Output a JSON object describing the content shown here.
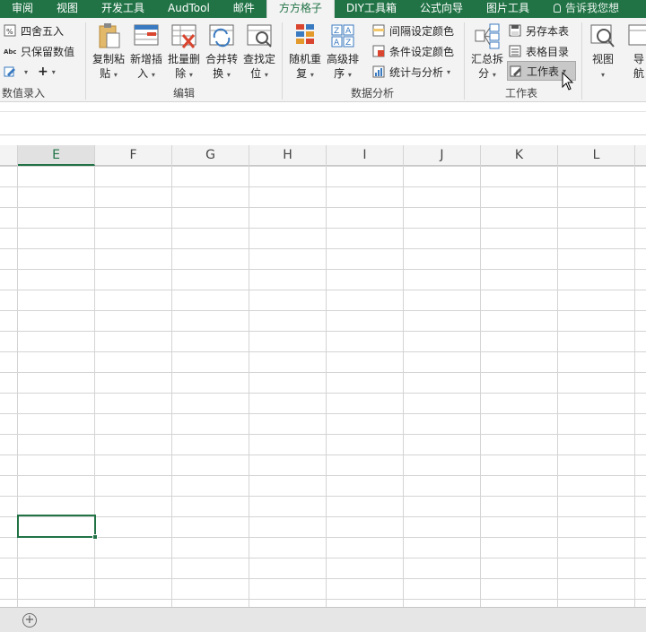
{
  "tabs": [
    {
      "label": "审阅"
    },
    {
      "label": "视图"
    },
    {
      "label": "开发工具"
    },
    {
      "label": "AudTool"
    },
    {
      "label": "邮件"
    },
    {
      "label": "方方格子",
      "active": true
    },
    {
      "label": "DIY工具箱"
    },
    {
      "label": "公式向导"
    },
    {
      "label": "图片工具"
    }
  ],
  "tell_me": "告诉我您想",
  "groups": {
    "numeric": {
      "label": "数值录入",
      "round_label": "四舍五入",
      "keep_label": "只保留数值",
      "plus_label": "+"
    },
    "edit": {
      "label": "编辑",
      "copy_paste": [
        "复制粘",
        "贴"
      ],
      "add_insert": [
        "新增插",
        "入"
      ],
      "batch_delete": [
        "批量删",
        "除"
      ],
      "merge_convert": [
        "合并转",
        "换"
      ],
      "find_locate": [
        "查找定",
        "位"
      ]
    },
    "analysis": {
      "label": "数据分析",
      "random_repeat": [
        "随机重",
        "复"
      ],
      "advanced_sort": [
        "高级排",
        "序"
      ],
      "interval_color": "间隔设定颜色",
      "cond_color": "条件设定颜色",
      "stats": "统计与分析"
    },
    "worksheet": {
      "label": "工作表",
      "summary_split": [
        "汇总拆",
        "分"
      ],
      "save_sheet": "另存本表",
      "sheet_catalog": "表格目录",
      "worksheet_btn": "工作表"
    },
    "view": {
      "view_btn": "视图",
      "nav_partial": [
        "导",
        "航"
      ]
    }
  },
  "columns": [
    "E",
    "F",
    "G",
    "H",
    "I",
    "J",
    "K",
    "L"
  ],
  "selected_column": "E",
  "colors": {
    "accent": "#217346",
    "ribbon_bg": "#f3f3f3",
    "grid_line": "#d4d4d4"
  }
}
